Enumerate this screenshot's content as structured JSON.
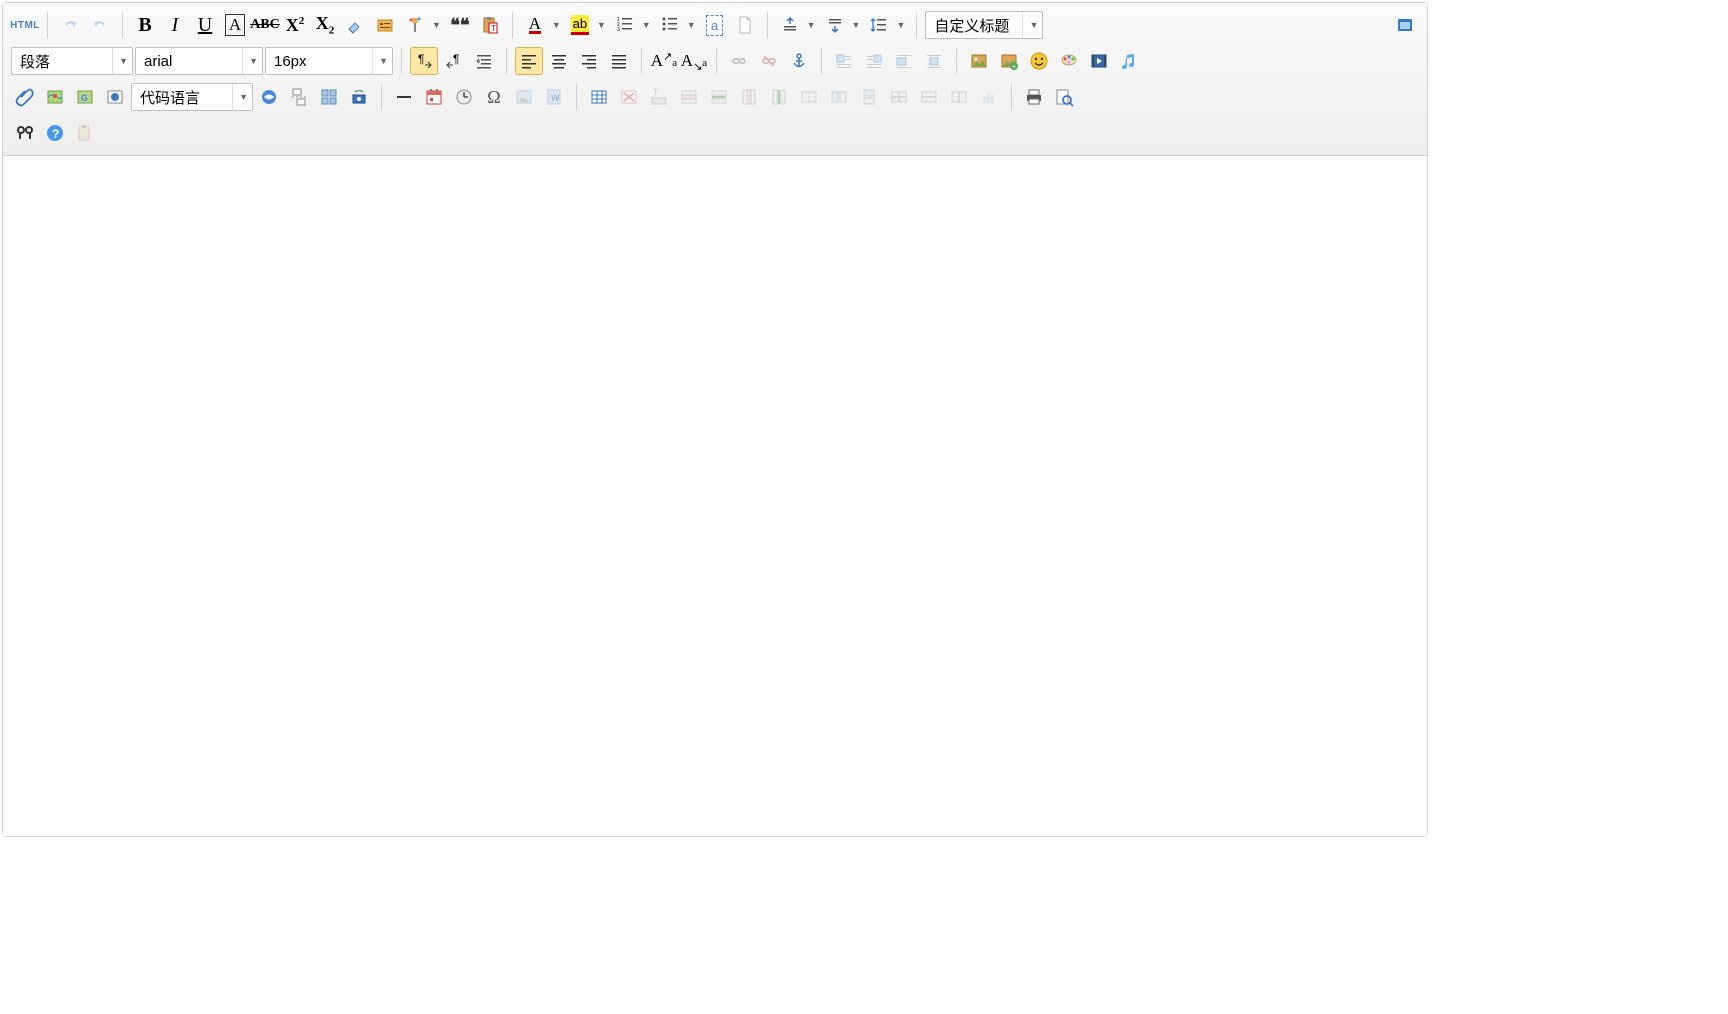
{
  "labels": {
    "html": "HTML",
    "bold": "B",
    "italic": "I",
    "underline": "U",
    "boxA": "A",
    "strike": "ABC",
    "sup": "X",
    "sup2": "2",
    "sub": "X",
    "sub2": "2",
    "fontcolor": "A",
    "highlight": "ab",
    "quote": "❝❝",
    "toupper": "A",
    "toupper_sub": "a",
    "tolower": "A",
    "tolower_sub": "a",
    "omega": "Ω",
    "word": "W",
    "chars": "a"
  },
  "selects": {
    "paragraph": "段落",
    "font": "arial",
    "size": "16px",
    "codelang": "代码语言",
    "heading": "自定义标题"
  },
  "tooltips": {
    "undo": "撤销",
    "redo": "重做",
    "bold": "加粗",
    "italic": "斜体",
    "underline": "下划线",
    "fontborder": "字符边框",
    "strike": "删除线",
    "superscript": "上标",
    "subscript": "下标",
    "eraser": "清除格式",
    "autotype": "自动排版",
    "format": "格式刷",
    "blockquote": "引用",
    "paste": "纯文本粘贴",
    "forecolor": "字体颜色",
    "backcolor": "背景色",
    "ol": "有序列表",
    "ul": "无序列表",
    "selectall": "全选",
    "newdoc": "新建",
    "rowspacetop": "段前距",
    "rowspacebottom": "段后距",
    "lineheight": "行间距",
    "customstyle": "自定义标题",
    "fullscreen": "全屏",
    "paragraph_sel": "段落格式",
    "font_sel": "字体",
    "size_sel": "字号",
    "dir_ltr": "从左向右",
    "dir_rtl": "从右向左",
    "indent": "首行缩进",
    "align_left": "左对齐",
    "align_center": "居中",
    "align_right": "右对齐",
    "align_justify": "两端对齐",
    "touppercase": "大写",
    "tolowercase": "小写",
    "link": "超链接",
    "unlink": "取消链接",
    "anchor": "锚点",
    "float_left": "左浮动",
    "float_right": "右浮动",
    "float_none": "默认",
    "float_center": "居中",
    "img_insert": "单图上传",
    "img_multi": "多图上传",
    "emotion": "表情",
    "scrawl": "涂鸦",
    "video": "视频",
    "music": "音乐",
    "attachment": "附件",
    "map": "Baidu地图",
    "gmap": "Google地图",
    "iframe": "插入Iframe",
    "codelang": "代码语言",
    "webapp": "百度应用",
    "pagebreak": "分页",
    "template": "模板",
    "snapscreen": "截图",
    "hr": "分隔线",
    "date": "日期",
    "time": "时间",
    "spechar": "特殊字符",
    "wordimage": "图片转存",
    "word": "Word导入",
    "table": "表格",
    "deltable": "删表",
    "delrow": "删行",
    "insrowup": "前插行",
    "insrowdown": "后插行",
    "delcol": "删列",
    "inscolleft": "前插列",
    "inscolright": "后插列",
    "merge": "合并",
    "splitrow": "拆行",
    "splitcol": "拆列",
    "chart": "图表",
    "print": "打印",
    "preview": "预览",
    "find": "查找替换",
    "help": "帮助",
    "draft": "草稿"
  }
}
